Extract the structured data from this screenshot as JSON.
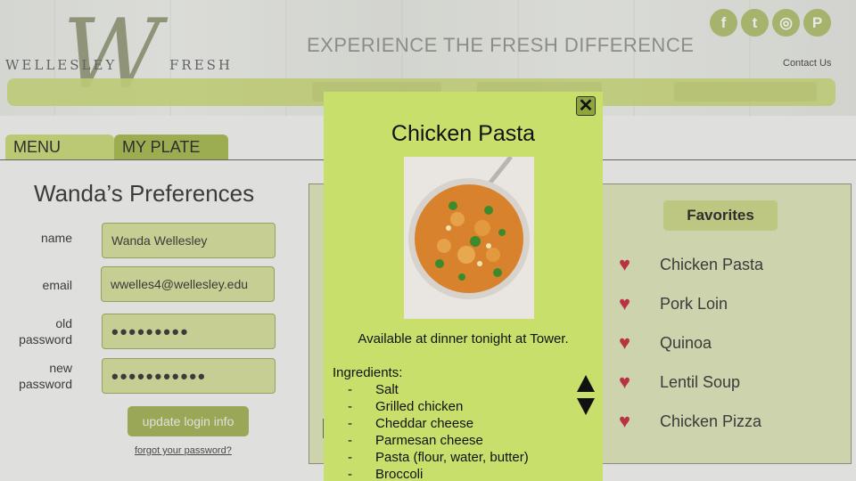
{
  "header": {
    "logo_letter": "W",
    "logo_left": "WELLESLEY",
    "logo_right": "FRESH",
    "tagline": "EXPERIENCE THE FRESH DIFFERENCE",
    "contact": "Contact Us",
    "social": [
      {
        "icon": "facebook-icon",
        "glyph": "f"
      },
      {
        "icon": "twitter-icon",
        "glyph": "t"
      },
      {
        "icon": "instagram-icon",
        "glyph": "◎"
      },
      {
        "icon": "pinterest-icon",
        "glyph": "P"
      }
    ]
  },
  "tabs": {
    "menu": "MENU",
    "my_plate": "MY PLATE"
  },
  "preferences": {
    "title": "Wanda’s Preferences",
    "name_label": "name",
    "name_value": "Wanda Wellesley",
    "email_label": "email",
    "email_value": "wwelles4@wellesley.edu",
    "old_password_label_1": "old",
    "old_password_label_2": "password",
    "old_password_value": "•••••••••",
    "new_password_label_1": "new",
    "new_password_label_2": "password",
    "new_password_value": "•••••••••••",
    "update_button": "update login info",
    "forgot_link": "forgot your password?"
  },
  "favorites": {
    "heading": "Favorites",
    "items": [
      "Chicken Pasta",
      "Pork Loin",
      "Quinoa",
      "Lentil Soup",
      "Chicken Pizza"
    ]
  },
  "modal": {
    "title": "Chicken Pasta",
    "availability": "Available at dinner tonight at Tower.",
    "ingredients_label": "Ingredients:",
    "ingredients": [
      "Salt",
      "Grilled chicken",
      "Cheddar cheese",
      "Parmesan cheese",
      "Pasta (flour, water, butter)",
      "Broccoli"
    ],
    "close_glyph": "✕",
    "dash": "-"
  },
  "colors": {
    "accent_green": "#c8e06b",
    "tab_dark": "#9eb23e",
    "heart": "#c0192b"
  }
}
